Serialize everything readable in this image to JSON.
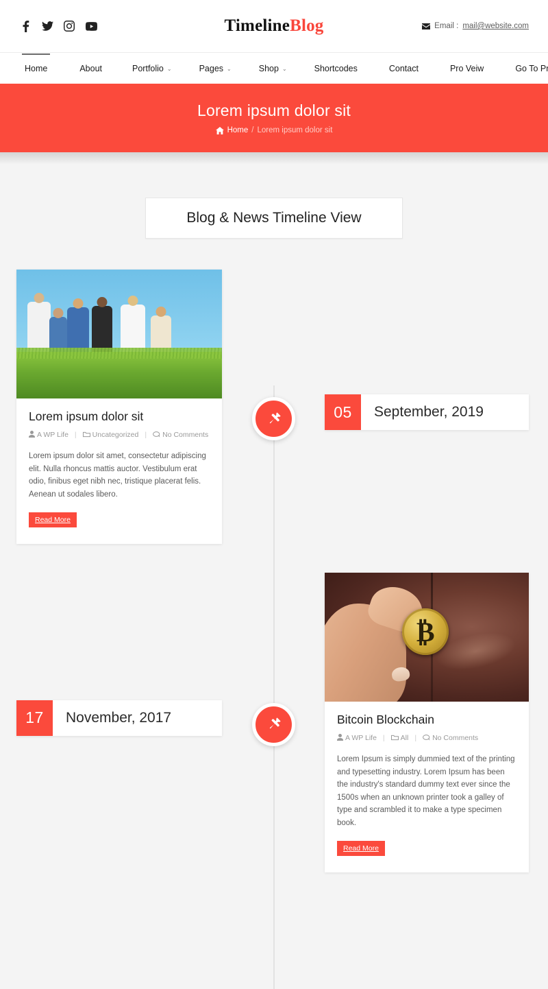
{
  "header": {
    "social": [
      {
        "name": "facebook-icon",
        "label": "Facebook"
      },
      {
        "name": "twitter-icon",
        "label": "Twitter"
      },
      {
        "name": "instagram-icon",
        "label": "Instagram"
      },
      {
        "name": "youtube-icon",
        "label": "YouTube"
      }
    ],
    "logo": {
      "primary": "Timeline",
      "accent": "Blog"
    },
    "email_label": "Email :",
    "email_address": "mail@website.com"
  },
  "nav": {
    "items": [
      {
        "label": "Home",
        "has_dropdown": false,
        "active": true
      },
      {
        "label": "About",
        "has_dropdown": false,
        "active": false
      },
      {
        "label": "Portfolio",
        "has_dropdown": true,
        "active": false
      },
      {
        "label": "Pages",
        "has_dropdown": true,
        "active": false
      },
      {
        "label": "Shop",
        "has_dropdown": true,
        "active": false
      },
      {
        "label": "Shortcodes",
        "has_dropdown": false,
        "active": false
      },
      {
        "label": "Contact",
        "has_dropdown": false,
        "active": false
      },
      {
        "label": "Pro Veiw",
        "has_dropdown": false,
        "active": false
      },
      {
        "label": "Go To Pro",
        "has_dropdown": false,
        "active": false
      }
    ]
  },
  "hero": {
    "title": "Lorem ipsum dolor sit",
    "breadcrumb_home": "Home",
    "breadcrumb_sep": "/",
    "breadcrumb_current": "Lorem ipsum dolor sit"
  },
  "timeline": {
    "heading": "Blog & News Timeline View",
    "entries": [
      {
        "side": "left",
        "pin_icon": "pushpin-icon",
        "post": {
          "title": "Lorem ipsum dolor sit",
          "author": "A WP Life",
          "category": "Uncategorized",
          "comments": "No Comments",
          "excerpt": "Lorem ipsum dolor sit amet, consectetur adipiscing elit. Nulla rhoncus mattis auctor. Vestibulum erat odio, finibus eget nibh nec, tristique placerat felis. Aenean ut sodales libero.",
          "read_more": "Read More",
          "image_alt": "group of hikers standing on a grassy hill under a blue sky"
        },
        "date": {
          "day": "05",
          "rest": "September, 2019"
        }
      },
      {
        "side": "right",
        "pin_icon": "pushpin-icon",
        "post": {
          "title": "Bitcoin Blockchain",
          "author": "A WP Life",
          "category": "All",
          "comments": "No Comments",
          "excerpt": "Lorem Ipsum is simply dummied text of the printing and typesetting industry. Lorem Ipsum has been the industry's standard dummy text ever since the 1500s when an unknown printer took a galley of type and scrambled it to make a type specimen book.",
          "read_more": "Read More",
          "image_alt": "hand holding a gold bitcoin coin in front of brown leather"
        },
        "date": {
          "day": "17",
          "rest": "November, 2017"
        }
      }
    ]
  },
  "colors": {
    "accent": "#fb4a3c",
    "page_bg": "#f4f4f4",
    "card_bg": "#ffffff",
    "text": "#333333",
    "muted": "#9a9a9a"
  }
}
